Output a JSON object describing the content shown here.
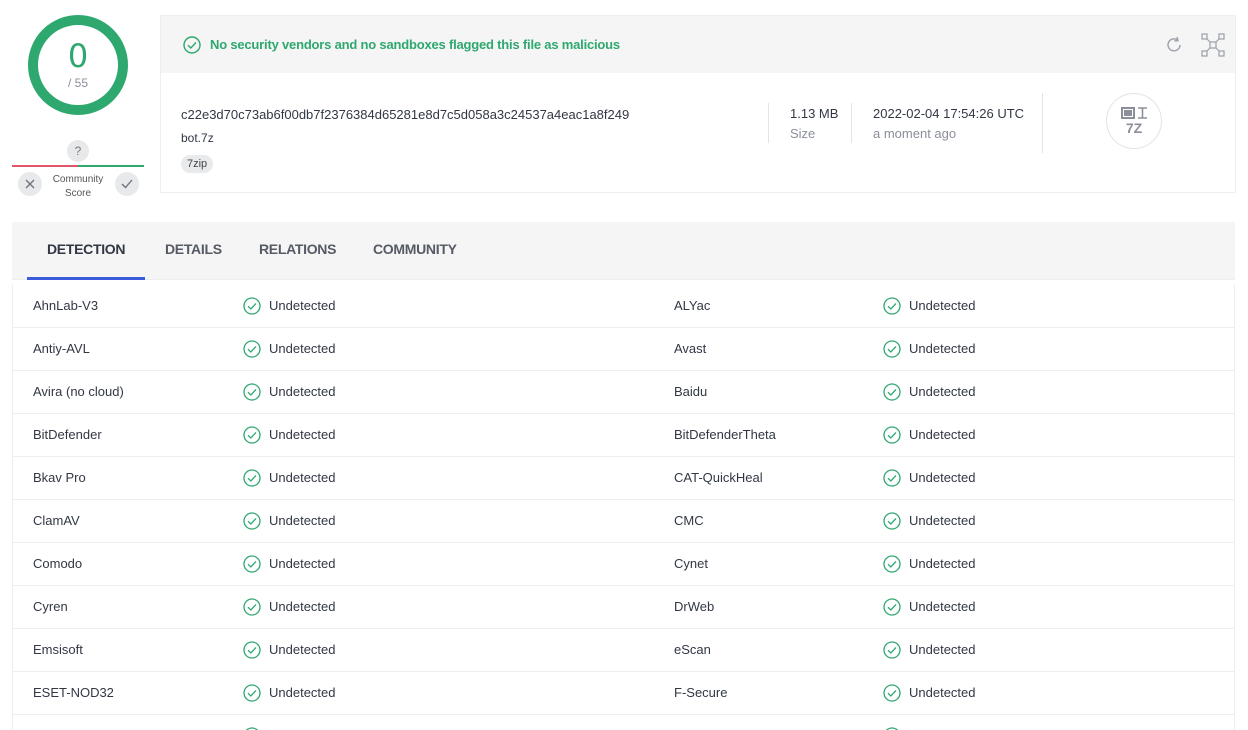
{
  "score": {
    "detections": "0",
    "total": "/ 55",
    "color": "#2ea86f"
  },
  "community": {
    "question": "?",
    "label_line1": "Community",
    "label_line2": "Score"
  },
  "banner": {
    "message": "No security vendors and no sandboxes flagged this file as malicious"
  },
  "file": {
    "hash": "c22e3d70c73ab6f00db7f2376384d65281e8d7c5d058a3c24537a4eac1a8f249",
    "name": "bot.7z",
    "tag": "7zip",
    "size_value": "1.13 MB",
    "size_label": "Size",
    "date_value": "2022-02-04 17:54:26 UTC",
    "date_label": "a moment ago",
    "type_icon_text": "7Z"
  },
  "tabs": [
    {
      "label": "DETECTION"
    },
    {
      "label": "DETAILS"
    },
    {
      "label": "RELATIONS"
    },
    {
      "label": "COMMUNITY"
    }
  ],
  "detections": [
    {
      "left_vendor": "AhnLab-V3",
      "left_status": "Undetected",
      "right_vendor": "ALYac",
      "right_status": "Undetected"
    },
    {
      "left_vendor": "Antiy-AVL",
      "left_status": "Undetected",
      "right_vendor": "Avast",
      "right_status": "Undetected"
    },
    {
      "left_vendor": "Avira (no cloud)",
      "left_status": "Undetected",
      "right_vendor": "Baidu",
      "right_status": "Undetected"
    },
    {
      "left_vendor": "BitDefender",
      "left_status": "Undetected",
      "right_vendor": "BitDefenderTheta",
      "right_status": "Undetected"
    },
    {
      "left_vendor": "Bkav Pro",
      "left_status": "Undetected",
      "right_vendor": "CAT-QuickHeal",
      "right_status": "Undetected"
    },
    {
      "left_vendor": "ClamAV",
      "left_status": "Undetected",
      "right_vendor": "CMC",
      "right_status": "Undetected"
    },
    {
      "left_vendor": "Comodo",
      "left_status": "Undetected",
      "right_vendor": "Cynet",
      "right_status": "Undetected"
    },
    {
      "left_vendor": "Cyren",
      "left_status": "Undetected",
      "right_vendor": "DrWeb",
      "right_status": "Undetected"
    },
    {
      "left_vendor": "Emsisoft",
      "left_status": "Undetected",
      "right_vendor": "eScan",
      "right_status": "Undetected"
    },
    {
      "left_vendor": "ESET-NOD32",
      "left_status": "Undetected",
      "right_vendor": "F-Secure",
      "right_status": "Undetected"
    },
    {
      "left_vendor": "",
      "left_status": "",
      "right_vendor": "",
      "right_status": ""
    }
  ],
  "colors": {
    "accent": "#2ea86f",
    "tab_indicator": "#3b5bdb",
    "negative": "#e0566b"
  }
}
